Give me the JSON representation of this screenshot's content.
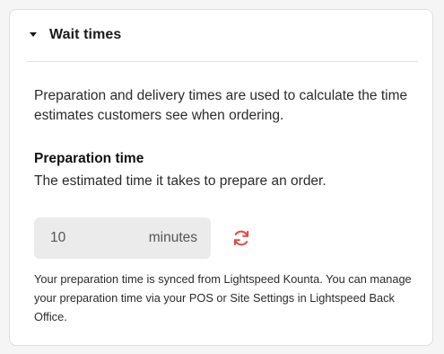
{
  "wait_times": {
    "title": "Wait times",
    "intro": "Preparation and delivery times are used to calculate the time estimates customers see when ordering.",
    "preparation": {
      "title": "Preparation time",
      "description": "The estimated time it takes to prepare an order.",
      "value": "10",
      "unit": "minutes",
      "sync_icon": "refresh-icon",
      "footnote": "Your preparation time is synced from Lightspeed Kounta. You can manage your preparation time via your POS or Site Settings in Lightspeed Back Office."
    }
  },
  "colors": {
    "sync_icon": "#e8453c",
    "card_border": "#dedede",
    "input_bg": "#ebebeb"
  }
}
